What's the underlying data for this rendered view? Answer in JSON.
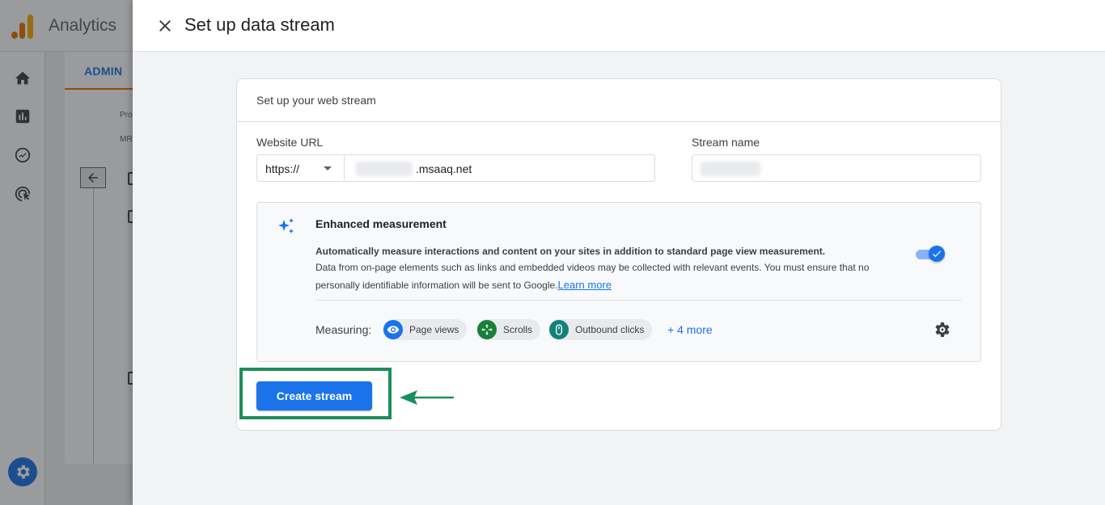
{
  "app": {
    "brand": "Analytics",
    "admin_tab": "ADMIN",
    "bg_property_label": "Pro",
    "bg_account_label": "MR"
  },
  "panel": {
    "title": "Set up data stream"
  },
  "card": {
    "heading": "Set up your web stream",
    "website_url_label": "Website URL",
    "protocol": "https://",
    "url_suffix": ".msaaq.net",
    "stream_name_label": "Stream name"
  },
  "enhanced": {
    "title": "Enhanced measurement",
    "line1": "Automatically measure interactions and content on your sites in addition to standard page view measurement.",
    "description": "Data from on-page elements such as links and embedded videos may be collected with relevant events. You must ensure that no personally identifiable information will be sent to Google.",
    "learn_more": "Learn more",
    "toggle_on": true,
    "measuring_label": "Measuring:",
    "chips": [
      {
        "label": "Page views",
        "icon": "eye-icon",
        "color": "#1a73e8"
      },
      {
        "label": "Scrolls",
        "icon": "scroll-arrows-icon",
        "color": "#188038"
      },
      {
        "label": "Outbound clicks",
        "icon": "mouse-icon",
        "color": "#12827a"
      }
    ],
    "more": "+ 4 more"
  },
  "actions": {
    "create_stream": "Create stream"
  },
  "colors": {
    "accent": "#1a73e8",
    "highlight": "#1e8e5a"
  }
}
